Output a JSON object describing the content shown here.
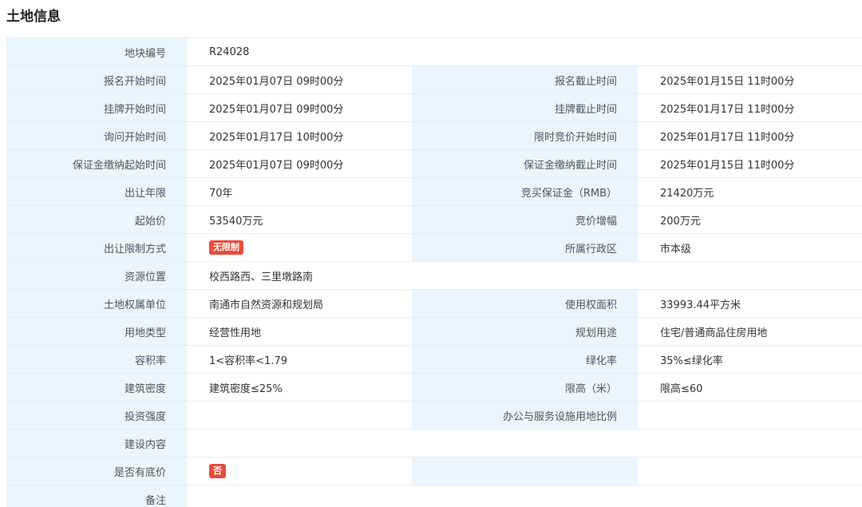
{
  "title": "土地信息",
  "rows": {
    "plot_no": {
      "label": "地块编号",
      "value": "R24028"
    },
    "reg_start": {
      "label": "报名开始时间",
      "value": "2025年01月07日 09时00分"
    },
    "reg_end": {
      "label": "报名截止时间",
      "value": "2025年01月15日 11时00分"
    },
    "list_start": {
      "label": "挂牌开始时间",
      "value": "2025年01月07日 09时00分"
    },
    "list_end": {
      "label": "挂牌截止时间",
      "value": "2025年01月17日 11时00分"
    },
    "inquiry_start": {
      "label": "询问开始时间",
      "value": "2025年01月17日 10时00分"
    },
    "bid_start": {
      "label": "限时竞价开始时间",
      "value": "2025年01月17日 11时00分"
    },
    "deposit_start": {
      "label": "保证金缴纳起始时间",
      "value": "2025年01月07日 09时00分"
    },
    "deposit_end": {
      "label": "保证金缴纳截止时间",
      "value": "2025年01月15日 11时00分"
    },
    "term": {
      "label": "出让年限",
      "value": "70年"
    },
    "deposit_amount": {
      "label": "竞买保证金（RMB）",
      "value": "21420万元"
    },
    "start_price": {
      "label": "起始价",
      "value": "53540万元"
    },
    "increment": {
      "label": "竞价增幅",
      "value": "200万元"
    },
    "restriction": {
      "label": "出让限制方式",
      "badge": "无限制"
    },
    "district": {
      "label": "所属行政区",
      "value": "市本级"
    },
    "location": {
      "label": "资源位置",
      "value": "校西路西、三里墩路南"
    },
    "owner": {
      "label": "土地权属单位",
      "value": "南通市自然资源和规划局"
    },
    "area": {
      "label": "使用权面积",
      "value": "33993.44平方米"
    },
    "land_type": {
      "label": "用地类型",
      "value": "经营性用地"
    },
    "planned_use": {
      "label": "规划用途",
      "value": "住宅/普通商品住房用地"
    },
    "far": {
      "label": "容积率",
      "value": "1<容积率<1.79"
    },
    "green": {
      "label": "绿化率",
      "value": "35%≤绿化率"
    },
    "density": {
      "label": "建筑密度",
      "value": "建筑密度≤25%"
    },
    "height": {
      "label": "限高（米）",
      "value": "限高≤60"
    },
    "investment": {
      "label": "投资强度",
      "value": ""
    },
    "office_ratio": {
      "label": "办公与服务设施用地比例",
      "value": ""
    },
    "content": {
      "label": "建设内容",
      "value": ""
    },
    "reserve": {
      "label": "是否有底价",
      "badge": "否"
    },
    "remarks": {
      "label": "备注"
    }
  }
}
